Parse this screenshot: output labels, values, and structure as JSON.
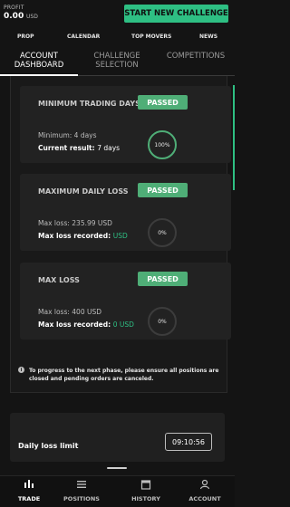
{
  "header": {
    "profit_label": "PROFIT",
    "profit_value": "0.00",
    "profit_currency": "USD",
    "cta_label": "START NEW CHALLENGE",
    "accent": "#2ebf83"
  },
  "nav_links": [
    "PROP",
    "CALENDAR",
    "TOP MOVERS",
    "NEWS"
  ],
  "tabs": [
    {
      "label": "ACCOUNT DASHBOARD",
      "active": true
    },
    {
      "label": "CHALLENGE SELECTION",
      "active": false
    },
    {
      "label": "COMPETITIONS",
      "active": false
    }
  ],
  "cards": [
    {
      "title": "MINIMUM TRADING DAYS",
      "status": "PASSED",
      "line1": "Minimum: 4 days",
      "line2_label": "Current result:",
      "line2_value": "7 days",
      "progress_text": "100%",
      "progress": 1.0
    },
    {
      "title": "MAXIMUM DAILY LOSS",
      "status": "PASSED",
      "line1": "Max loss: 235.99 USD",
      "line2_label": "Max loss recorded:",
      "line2_value": "USD",
      "progress_text": "0%",
      "progress": 0.0
    },
    {
      "title": "MAX LOSS",
      "status": "PASSED",
      "line1": "Max loss: 400 USD",
      "line2_label": "Max loss recorded:",
      "line2_value": "0 USD",
      "progress_text": "0%",
      "progress": 0.0
    }
  ],
  "note": "To progress to the next phase, please ensure all positions are closed and pending orders are canceled.",
  "daily_loss": {
    "label": "Daily loss limit",
    "timer": "09:10:56"
  },
  "bottom_nav": [
    {
      "label": "TRADE",
      "icon": "trade-icon",
      "active": true
    },
    {
      "label": "POSITIONS",
      "icon": "positions-icon",
      "active": false
    },
    {
      "label": "HISTORY",
      "icon": "history-icon",
      "active": false
    },
    {
      "label": "ACCOUNT",
      "icon": "account-icon",
      "active": false
    }
  ]
}
